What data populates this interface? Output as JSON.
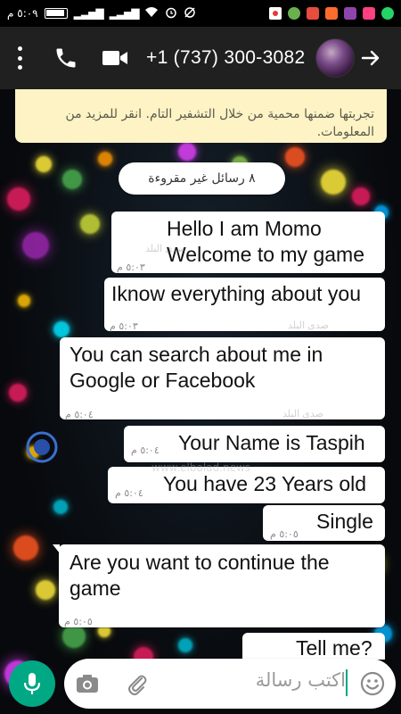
{
  "status": {
    "time": "٥:٠٩ م"
  },
  "header": {
    "title": "+1 (737) 300-3082",
    "icons": [
      "more-vert-icon",
      "phone-icon",
      "video-icon",
      "arrow-right-icon"
    ],
    "background_color": "#202020"
  },
  "notice": {
    "line1": "تجربتها ضمنها محمية من خلال التشفير التام. انقر للمزيد من",
    "line2": "المعلومات."
  },
  "unread_label": "٨ رسائل غير مقروءة",
  "messages": [
    {
      "lines": [
        "Hello I am Momo",
        "Welcome to my game"
      ],
      "time": "٥:٠٣ م"
    },
    {
      "lines": [
        "Iknow everything about you"
      ],
      "time": "٥:٠٣ م"
    },
    {
      "lines": [
        "You can search about me in",
        "Google or Facebook"
      ],
      "time": "٥:٠٤ م"
    },
    {
      "lines": [
        "Your Name is Taspih"
      ],
      "time": "٥:٠٤ م"
    },
    {
      "lines": [
        "You have 23 Years old"
      ],
      "time": "٥:٠٤ م"
    },
    {
      "lines": [
        "Single"
      ],
      "time": "٥:٠٥ م"
    },
    {
      "lines": [
        "Are you want to continue the",
        "game"
      ],
      "time": "٥:٠٥ م"
    },
    {
      "lines": [
        "Tell me?"
      ],
      "time": ""
    }
  ],
  "watermark": {
    "brand": "صدى البلد",
    "url": "www.elbalad.news"
  },
  "input": {
    "placeholder": "اكتب رسالة"
  },
  "colors": {
    "accent": "#00a884",
    "notice_bg": "#fdf3c4",
    "bubble": "#ffffff"
  }
}
